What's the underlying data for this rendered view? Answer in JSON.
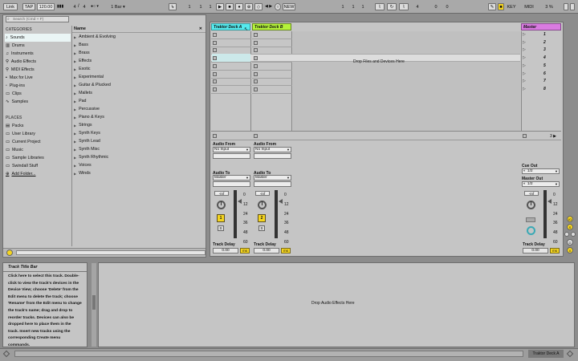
{
  "transport": {
    "link": "Link",
    "tap": "TAP",
    "tempo": "120.00",
    "sig_num": "4",
    "sig_den": "4",
    "metronome": "●○ ▾",
    "quantize": "1 Bar ▾",
    "pos1": "1",
    "pos2": "1",
    "pos3": "1",
    "arrows": "◀ ▶",
    "new": "NEW",
    "loop1": "1",
    "loop2": "1",
    "loop3": "1",
    "len1": "4",
    "len2": "0",
    "len3": "0",
    "key": "KEY",
    "midi": "MIDI",
    "cpu": "3 %",
    "d_label": "D"
  },
  "browser": {
    "search_placeholder": "Search (Cmd + F)",
    "categories_header": "CATEGORIES",
    "categories": [
      "Sounds",
      "Drums",
      "Instruments",
      "Audio Effects",
      "MIDI Effects",
      "Max for Live",
      "Plug-ins",
      "Clips",
      "Samples"
    ],
    "places_header": "PLACES",
    "places": [
      "Packs",
      "User Library",
      "Current Project",
      "Music",
      "Sample Libraries",
      "Swindall Stuff",
      "Add Folder..."
    ],
    "name_header": "Name",
    "items": [
      "Ambient & Evolving",
      "Bass",
      "Brass",
      "Effects",
      "Exotic",
      "Experimental",
      "Guitar & Plucked",
      "Mallets",
      "Pad",
      "Percussive",
      "Piano & Keys",
      "Strings",
      "Synth Keys",
      "Synth Lead",
      "Synth Misc",
      "Synth Rhythmic",
      "Voices",
      "Winds"
    ]
  },
  "session": {
    "tracks": [
      "Traktor Deck A",
      "Traktor Deck B"
    ],
    "master": "Master",
    "drop_files": "Drop Files and Devices Here",
    "scenes": [
      "1",
      "2",
      "3",
      "4",
      "5",
      "6",
      "7",
      "8"
    ],
    "audio_from": "Audio From",
    "no_input": "No Input",
    "audio_to": "Audio To",
    "master_out_value": "Master",
    "cue_out": "Cue Out",
    "cue_value": "1/2",
    "master_out": "Master Out",
    "master_out_sel": "1/2",
    "vol": "-Inf",
    "db_ticks": [
      "0",
      "12",
      "24",
      "36",
      "48",
      "60"
    ],
    "track1_num": "1",
    "track2_num": "2",
    "solo": "S",
    "track_delay": "Track Delay",
    "delay_value": "0.00",
    "ms": "ms",
    "scene_ratio": "3 ▶"
  },
  "info": {
    "title": "Track Title Bar",
    "body": "Click here to select this track. Double-click to view the track's devices in the Device View; choose 'Delete' from the Edit menu to delete the track; choose 'Rename' from the Edit menu to change the track's name; drag and drop to reorder tracks. Devices can also be dropped here to place them in the track. Insert new tracks using the corresponding Create menu commands."
  },
  "device": {
    "drop_effects": "Drop Audio Effects Here"
  },
  "status": {
    "selected_track": "Traktor Deck A"
  },
  "colors": {
    "track_a": "#55eaee",
    "track_b": "#b4f23a",
    "master": "#d97be1",
    "accent": "#f5d51f"
  }
}
